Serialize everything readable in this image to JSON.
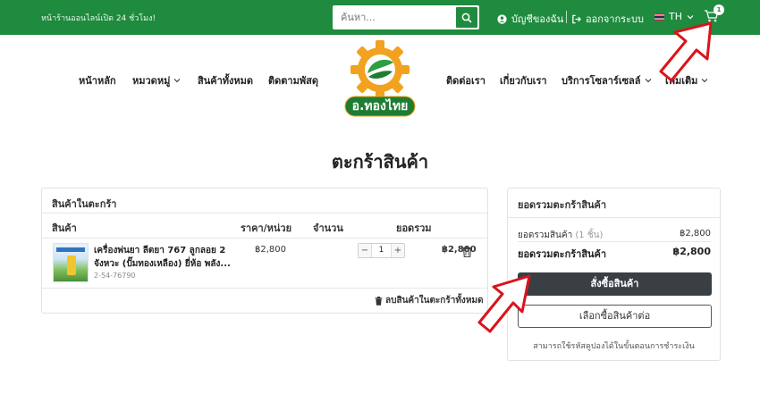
{
  "topbar": {
    "promo": "หน้าร้านออนไลน์เปิด 24 ชั่วโมง!",
    "search_placeholder": "ค้นหา...",
    "account": "บัญชีของฉัน",
    "logout": "ออกจากระบบ",
    "language": "TH",
    "cart_count": "1"
  },
  "nav": {
    "left": [
      "หน้าหลัก",
      "หมวดหมู่",
      "สินค้าทั้งหมด",
      "ติดตามพัสดุ"
    ],
    "right": [
      "ติดต่อเรา",
      "เกี่ยวกับเรา",
      "บริการโซลาร์เซลล์",
      "เพิ่มเติม"
    ]
  },
  "logo": {
    "text": "อ.ทองไทย"
  },
  "page": {
    "title": "ตะกร้าสินค้า"
  },
  "cart": {
    "heading": "สินค้าในตะกร้า",
    "columns": [
      "สินค้า",
      "ราคา/หน่วย",
      "จำนวน",
      "ยอดรวม"
    ],
    "items": [
      {
        "name": "เครื่องพ่นยา ลีตยา 767 ลูกลอย 2 จังหวะ (ปั๊มทองเหลือง) ยี่ห้อ พลัง...",
        "sku": "2-54-76790",
        "price": "฿2,800",
        "qty": "1",
        "total": "฿2,800"
      }
    ],
    "clear_all": "ลบสินค้าในตะกร้าทั้งหมด"
  },
  "summary": {
    "heading": "ยอดรวมตะกร้าสินค้า",
    "subtotal_label": "ยอดรวมสินค้า",
    "subtotal_count": "(1 ชิ้น)",
    "subtotal_value": "฿2,800",
    "total_label": "ยอดรวมตะกร้าสินค้า",
    "total_value": "฿2,800",
    "checkout": "สั่งซื้อสินค้า",
    "continue": "เลือกซื้อสินค้าต่อ",
    "coupon_note": "สามารถใช้รหัสคูปองได้ในขั้นตอนการชำระเงิน"
  },
  "colors": {
    "brand_green": "#1e8b3f",
    "dark_button": "#3a3f44",
    "annotation_red": "#d9141b"
  }
}
